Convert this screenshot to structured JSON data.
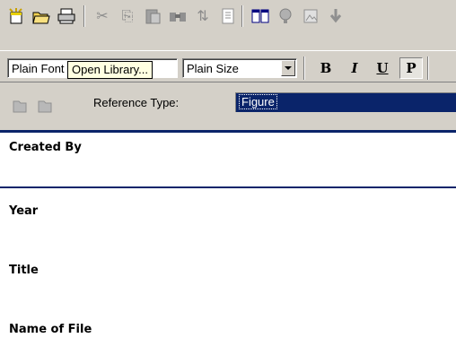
{
  "toolbar1": {
    "buttons": [
      {
        "name": "new-reference",
        "glyph": "✎"
      },
      {
        "name": "open-library",
        "glyph": "📂"
      },
      {
        "name": "print",
        "glyph": "🖶"
      },
      {
        "name": "cut",
        "glyph": "✂"
      },
      {
        "name": "copy",
        "glyph": "⎘"
      },
      {
        "name": "paste",
        "glyph": "📋"
      },
      {
        "name": "find",
        "glyph": "🔭"
      },
      {
        "name": "sort",
        "glyph": "⇅"
      },
      {
        "name": "format",
        "glyph": "▤"
      },
      {
        "name": "show-all",
        "glyph": "▥"
      },
      {
        "name": "online-search",
        "glyph": "🌐"
      },
      {
        "name": "image",
        "glyph": "🖼"
      },
      {
        "name": "download",
        "glyph": "⇓"
      }
    ]
  },
  "toolbar2": {
    "font": "Plain Font",
    "size": "Plain Size",
    "bold": "B",
    "italic": "I",
    "underline": "U",
    "plain": "P"
  },
  "tooltip": "Open Library...",
  "toolbar3": {
    "reference_type_label": "Reference Type:",
    "reference_type_value": "Figure"
  },
  "fields": {
    "created_by": "Created By",
    "year": "Year",
    "title": "Title",
    "name_of_file": "Name of File"
  }
}
